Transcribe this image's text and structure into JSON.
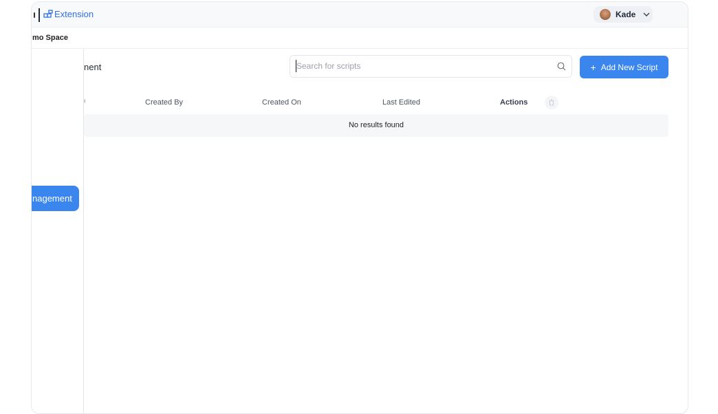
{
  "header": {
    "brand_label": "Extension",
    "user_name": "Kade"
  },
  "space": {
    "name": "mo Space"
  },
  "sidebar": {
    "active_item_label": "nagement"
  },
  "main": {
    "page_title": "nent",
    "search": {
      "placeholder": "Search for scripts",
      "value": ""
    },
    "add_button_label": "Add New Script",
    "add_button_icon": "+",
    "table": {
      "columns": [
        "Created By",
        "Created On",
        "Last Edited",
        "Actions"
      ],
      "empty_message": "No results found"
    }
  },
  "colors": {
    "accent": "#3a86ee",
    "brand_text": "#2f6fe4",
    "row_bg": "#f6f7f9"
  }
}
